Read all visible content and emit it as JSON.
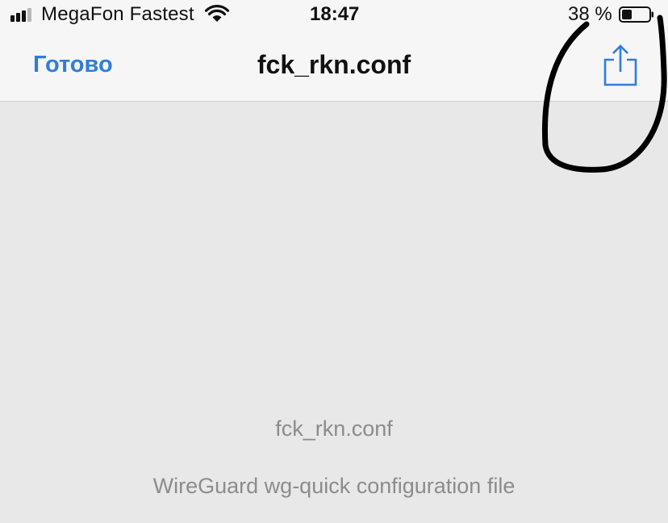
{
  "status_bar": {
    "carrier": "MegaFon Fastest",
    "signal_bars_active": 3,
    "signal_bars_total": 4,
    "time": "18:47",
    "battery_percent_label": "38 %",
    "battery_level": 0.38,
    "icons": [
      "signal-icon",
      "wifi-icon",
      "battery-icon"
    ]
  },
  "nav": {
    "done_label": "Готово",
    "title": "fck_rkn.conf",
    "share_icon": "share-icon",
    "accent_color": "#2f7ed8"
  },
  "preview": {
    "file_name": "fck_rkn.conf",
    "file_description": "WireGuard wg-quick configuration file"
  },
  "annotation": {
    "type": "hand-drawn-circle",
    "color": "#000000",
    "target": "share-button"
  }
}
